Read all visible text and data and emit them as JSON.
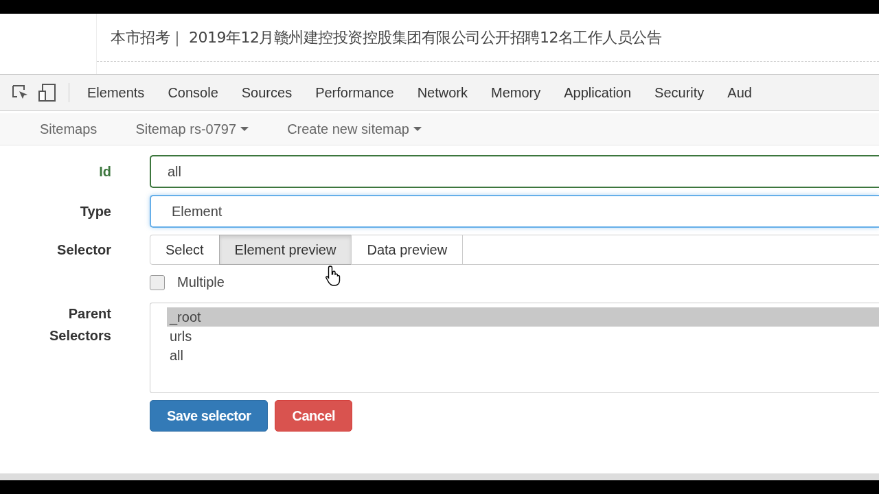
{
  "page": {
    "heading": "本市招考｜ 2019年12月赣州建控投资控股集团有限公司公开招聘12名工作人员公告"
  },
  "devtools": {
    "tabs": [
      "Elements",
      "Console",
      "Sources",
      "Performance",
      "Network",
      "Memory",
      "Application",
      "Security",
      "Aud"
    ]
  },
  "nav": [
    {
      "label": "Sitemaps",
      "dropdown": false
    },
    {
      "label": "Sitemap rs-0797",
      "dropdown": true
    },
    {
      "label": "Create new sitemap",
      "dropdown": true
    }
  ],
  "form": {
    "id": {
      "label": "Id",
      "value": "all"
    },
    "type": {
      "label": "Type",
      "value": "Element"
    },
    "selector": {
      "label": "Selector",
      "buttons": [
        {
          "label": "Select",
          "pressed": false
        },
        {
          "label": "Element preview",
          "pressed": true
        },
        {
          "label": "Data preview",
          "pressed": false
        }
      ]
    },
    "multiple": {
      "label": "Multiple",
      "checked": false
    },
    "parent_selectors": {
      "label_lines": [
        "Parent",
        "Selectors"
      ],
      "options": [
        {
          "label": "_root",
          "selected": true
        },
        {
          "label": "urls",
          "selected": false
        },
        {
          "label": "all",
          "selected": false
        }
      ]
    },
    "actions": [
      {
        "label": "Save selector",
        "kind": "primary"
      },
      {
        "label": "Cancel",
        "kind": "danger"
      }
    ]
  }
}
